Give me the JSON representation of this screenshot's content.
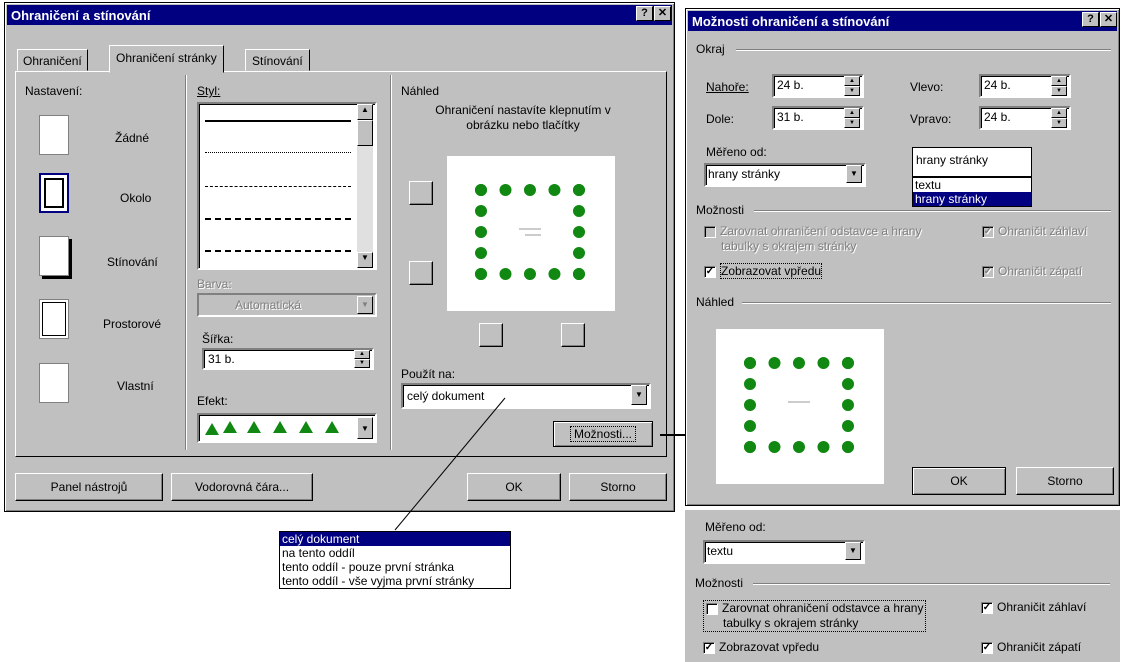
{
  "dlg1": {
    "title": "Ohraničení a stínování",
    "help": "?",
    "close": "✕",
    "tabs": [
      "Ohraničení",
      "Ohraničení stránky",
      "Stínování"
    ],
    "nastaveni_label": "Nastavení:",
    "settings": [
      "Žádné",
      "Okolo",
      "Stínování",
      "Prostorové",
      "Vlastní"
    ],
    "styl_label": "Styl:",
    "barva_label": "Barva:",
    "barva_value": "Automatická",
    "sirka_label": "Šířka:",
    "sirka_value": "31 b.",
    "efekt_label": "Efekt:",
    "nahled_label": "Náhled",
    "nahled_hint": "Ohraničení nastavíte klepnutím v obrázku nebo tlačítky",
    "pouzit_label": "Použít na:",
    "pouzit_value": "celý dokument",
    "moznosti_button": "Možnosti...",
    "panel_button": "Panel nástrojů",
    "vodorovna_button": "Vodorovná čára...",
    "ok": "OK",
    "storno": "Storno"
  },
  "applyList": [
    "celý dokument",
    "na tento oddíl",
    "tento oddíl - pouze první stránka",
    "tento oddíl - vše vyjma první stránky"
  ],
  "dlg2": {
    "title": "Možnosti ohraničení a stínování",
    "help": "?",
    "close": "✕",
    "okraj_label": "Okraj",
    "nahore_label": "Nahoře:",
    "nahore_value": "24 b.",
    "dole_label": "Dole:",
    "dole_value": "31 b.",
    "vlevo_label": "Vlevo:",
    "vlevo_value": "24 b.",
    "vpravo_label": "Vpravo:",
    "vpravo_value": "24 b.",
    "mereno_label": "Měřeno od:",
    "mereno_value": "hrany stránky",
    "mereno_options": [
      "hrany stránky",
      "textu",
      "hrany stránky"
    ],
    "moznosti_label": "Možnosti",
    "zarovnat": "Zarovnat ohraničení odstavce a hrany tabulky s okrajem stránky",
    "zarovnat_l1": "Zarovnat ohraničení odstavce a hrany",
    "zarovnat_l2": "tabulky s okrajem stránky",
    "zahlavi": "Ohraničit záhlaví",
    "zapati": "Ohraničit zápatí",
    "vpredu": "Zobrazovat vpředu",
    "nahled_label": "Náhled",
    "ok": "OK",
    "storno": "Storno"
  },
  "panel3": {
    "mereno_label": "Měřeno od:",
    "mereno_value": "textu",
    "moznosti_label": "Možnosti",
    "zarovnat_l1": "Zarovnat ohraničení odstavce a hrany",
    "zarovnat_l2": "tabulky s okrajem stránky",
    "zahlavi": "Ohraničit záhlaví",
    "zapati": "Ohraničit zápatí",
    "vpredu": "Zobrazovat vpředu"
  }
}
